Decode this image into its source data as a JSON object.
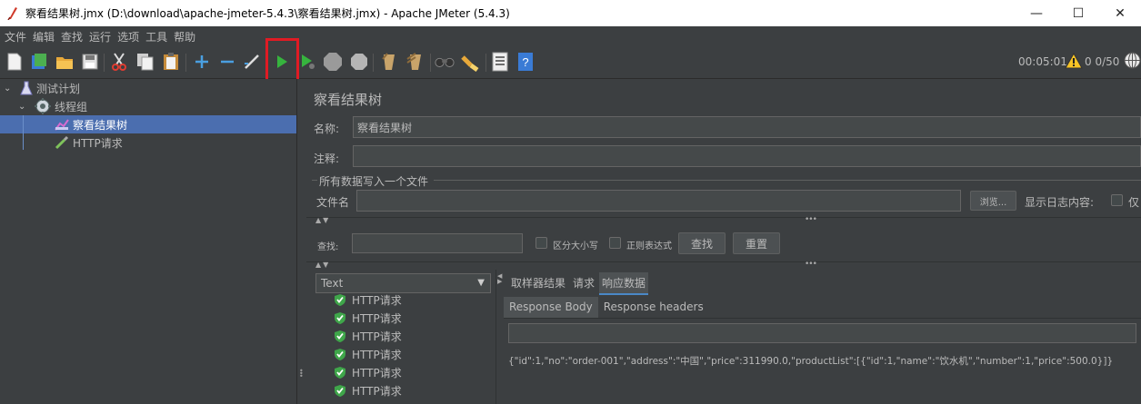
{
  "window": {
    "title": "察看结果树.jmx (D:\\download\\apache-jmeter-5.4.3\\察看结果树.jmx) - Apache JMeter (5.4.3)",
    "minimize": "—",
    "maximize": "☐",
    "close": "✕"
  },
  "menu": [
    "文件",
    "编辑",
    "查找",
    "运行",
    "选项",
    "工具",
    "帮助"
  ],
  "toolbar": {
    "tooltip": "启动",
    "elapsed_time": "00:05:01",
    "thread_count": "0 0/50",
    "icons": [
      "new-icon",
      "templates-icon",
      "open-icon",
      "save-icon",
      "cut-icon",
      "copy-icon",
      "paste-icon",
      "expand-icon",
      "collapse-icon",
      "toggle-icon",
      "start-icon",
      "start-no-pauses-icon",
      "stop-icon",
      "shutdown-icon",
      "clear-icon",
      "clear-all-icon",
      "search-icon",
      "reset-search-icon",
      "function-helper-icon",
      "help-icon"
    ]
  },
  "tree": {
    "items": [
      {
        "label": "测试计划",
        "icon": "flask-icon"
      },
      {
        "label": "线程组",
        "icon": "gear-icon"
      },
      {
        "label": "察看结果树",
        "icon": "chart-icon",
        "selected": true
      },
      {
        "label": "HTTP请求",
        "icon": "pipette-icon"
      }
    ]
  },
  "panel": {
    "title": "察看结果树",
    "name_label": "名称:",
    "name_value": "察看结果树",
    "comment_label": "注释:",
    "comment_value": "",
    "file_group_label": "所有数据写入一个文件",
    "filename_label": "文件名",
    "browse_button": "浏览...",
    "log_label": "显示日志内容:",
    "log_option": "仅",
    "search_label": "查找:",
    "case_sensitive_label": "区分大小写",
    "regex_label": "正则表达式",
    "search_button": "查找",
    "reset_button": "重置",
    "renderer_value": "Text",
    "results": [
      "HTTP请求",
      "HTTP请求",
      "HTTP请求",
      "HTTP请求",
      "HTTP请求",
      "HTTP请求"
    ],
    "tabs": [
      "取样器结果",
      "请求",
      "响应数据"
    ],
    "active_tab": "响应数据",
    "subtabs": [
      "Response Body",
      "Response headers"
    ],
    "active_subtab": "Response Body",
    "response_body": "{\"id\":1,\"no\":\"order-001\",\"address\":\"中国\",\"price\":311990.0,\"productList\":[{\"id\":1,\"name\":\"饮水机\",\"number\":1,\"price\":500.0}]}"
  },
  "colors": {
    "background": "#3c3f41",
    "selection": "#4b6eaf",
    "highlight_box": "#e01b24",
    "success_icon": "#4caf50"
  }
}
